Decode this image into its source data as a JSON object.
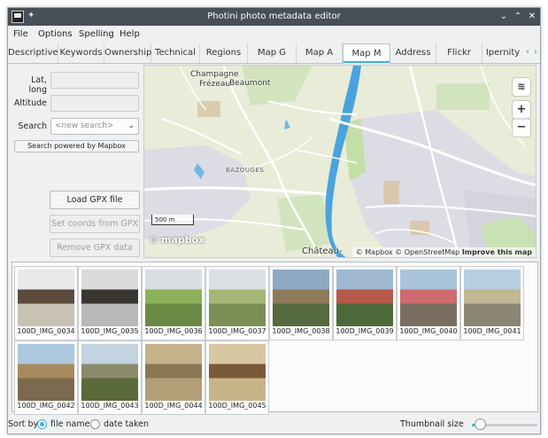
{
  "window": {
    "title": "Photini photo metadata editor"
  },
  "menu": [
    "File",
    "Options",
    "Spelling",
    "Help"
  ],
  "tabs": [
    {
      "label": "Descriptive",
      "active": false
    },
    {
      "label": "Keywords",
      "active": false
    },
    {
      "label": "Ownership",
      "active": false
    },
    {
      "label": "Technical",
      "active": false
    },
    {
      "label": "Regions",
      "active": false
    },
    {
      "label": "Map G",
      "active": false
    },
    {
      "label": "Map A",
      "active": false
    },
    {
      "label": "Map M",
      "active": true
    },
    {
      "label": "Address",
      "active": false
    },
    {
      "label": "Flickr",
      "active": false
    },
    {
      "label": "Ipernity",
      "active": false
    }
  ],
  "tab_scroll": {
    "left": "‹",
    "right": "›"
  },
  "left": {
    "latlong_label": "Lat, long",
    "latlong_value": "",
    "altitude_label": "Altitude",
    "altitude_value": "",
    "search_label": "Search",
    "search_placeholder": "<new search>",
    "search_powered": "Search powered by Mapbox",
    "load_gpx": "Load GPX file",
    "set_coords": "Set coords from GPX",
    "remove_gpx": "Remove GPX data"
  },
  "map": {
    "places": {
      "champagne": "Champagne",
      "frezeau": "Frézeau",
      "beaumont": "Beaumont",
      "bazouges": "BAZOUGES",
      "chateau": "Château-"
    },
    "scale": "500 m",
    "logo": "mapbox",
    "attribution": {
      "mapbox": "© Mapbox",
      "osm": "© OpenStreetMap",
      "improve": "Improve this map"
    },
    "controls": {
      "layers": "layers-icon",
      "zoom_in": "+",
      "zoom_out": "−"
    },
    "colors": {
      "land": "#e8ecd9",
      "park": "#c9e2b3",
      "water": "#4aa3df",
      "road": "#ffffff",
      "urban": "#d9d9e3"
    }
  },
  "thumbnails": [
    {
      "name": "100D_IMG_0034",
      "bg": "#c8c2b3",
      "fg": "#5a4a3c",
      "sky": "#e8e8ea"
    },
    {
      "name": "100D_IMG_0035",
      "bg": "#b8b9b6",
      "fg": "#3a352f",
      "sky": "#d9dadb"
    },
    {
      "name": "100D_IMG_0036",
      "bg": "#6a8a43",
      "fg": "#8db05a",
      "sky": "#d8dde2"
    },
    {
      "name": "100D_IMG_0037",
      "bg": "#7c8f56",
      "fg": "#a5b676",
      "sky": "#dbe0e4"
    },
    {
      "name": "100D_IMG_0038",
      "bg": "#566b3f",
      "fg": "#8e7a5a",
      "sky": "#8fa9c4"
    },
    {
      "name": "100D_IMG_0039",
      "bg": "#4c6a3a",
      "fg": "#b6584a",
      "sky": "#9fb8cf"
    },
    {
      "name": "100D_IMG_0040",
      "bg": "#7a6e60",
      "fg": "#cf6a6e",
      "sky": "#a9c3d8"
    },
    {
      "name": "100D_IMG_0041",
      "bg": "#8b8573",
      "fg": "#c3b693",
      "sky": "#b7cde0"
    },
    {
      "name": "100D_IMG_0042",
      "bg": "#7b6a4f",
      "fg": "#a88a5e",
      "sky": "#aec8de"
    },
    {
      "name": "100D_IMG_0043",
      "bg": "#5a6a3a",
      "fg": "#8b8a6a",
      "sky": "#c2d3e2"
    },
    {
      "name": "100D_IMG_0044",
      "bg": "#b39e77",
      "fg": "#8a7756",
      "sky": "#c6b28a"
    },
    {
      "name": "100D_IMG_0045",
      "bg": "#c9b48a",
      "fg": "#7b5a3a",
      "sky": "#d8c8a2"
    }
  ],
  "status": {
    "sort_by": "Sort by",
    "file_name": "file name",
    "date_taken": "date taken",
    "sort_selected": "file name",
    "thumb_size_label": "Thumbnail size",
    "thumb_size_fraction": 0.12
  }
}
